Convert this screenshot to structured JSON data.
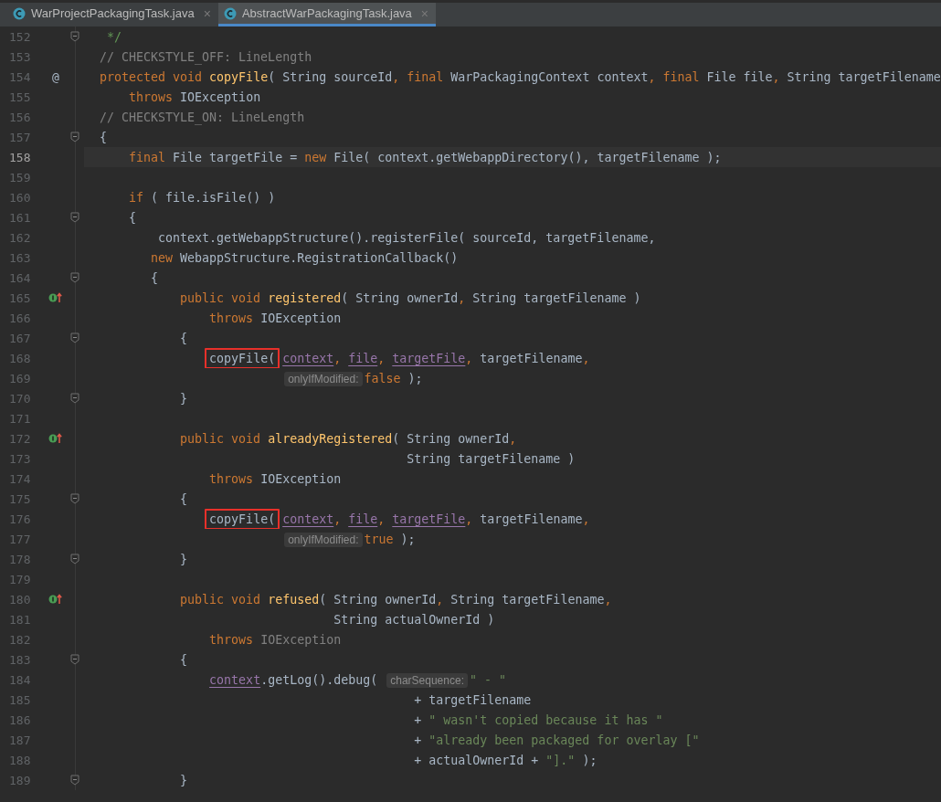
{
  "tabs": [
    {
      "label": "WarProjectPackagingTask.java",
      "close": "×",
      "selected": false
    },
    {
      "label": "AbstractWarPackagingTask.java",
      "close": "×",
      "selected": true
    }
  ],
  "lines": [
    {
      "number": "152",
      "fold": true,
      "segments": [
        {
          "kind": "doc",
          "text": " */"
        }
      ]
    },
    {
      "number": "153",
      "segments": [
        {
          "kind": "comment",
          "text": "// CHECKSTYLE_OFF: LineLength"
        }
      ]
    },
    {
      "number": "154",
      "annotation": "@",
      "segments": [
        {
          "kind": "kw",
          "text": "protected void "
        },
        {
          "kind": "decl",
          "text": "copyFile"
        },
        {
          "kind": "plain",
          "text": "( String sourceId"
        },
        {
          "kind": "kw",
          "text": ", final "
        },
        {
          "kind": "plain",
          "text": "WarPackagingContext context"
        },
        {
          "kind": "kw",
          "text": ", final "
        },
        {
          "kind": "plain",
          "text": "File file"
        },
        {
          "kind": "kw",
          "text": ", "
        },
        {
          "kind": "plain",
          "text": "String targetFilename"
        }
      ]
    },
    {
      "number": "155",
      "segments": [
        {
          "kind": "kw",
          "text": "    throws "
        },
        {
          "kind": "plain",
          "text": "IOException"
        }
      ]
    },
    {
      "number": "156",
      "segments": [
        {
          "kind": "comment",
          "text": "// CHECKSTYLE_ON: LineLength"
        }
      ]
    },
    {
      "number": "157",
      "fold": true,
      "segments": [
        {
          "kind": "plain",
          "text": "{"
        }
      ]
    },
    {
      "number": "158",
      "current": true,
      "segments": [
        {
          "kind": "kw",
          "text": "    final "
        },
        {
          "kind": "plain",
          "text": "File targetFile = "
        },
        {
          "kind": "kw",
          "text": "new "
        },
        {
          "kind": "plain",
          "text": "File( context.getWebappDirectory(), targetFilename );"
        }
      ]
    },
    {
      "number": "159"
    },
    {
      "number": "160",
      "segments": [
        {
          "kind": "kw",
          "text": "    if "
        },
        {
          "kind": "plain",
          "text": "( file.isFile() )"
        }
      ]
    },
    {
      "number": "161",
      "fold": true,
      "segments": [
        {
          "kind": "plain",
          "text": "    {"
        }
      ]
    },
    {
      "number": "162",
      "segments": [
        {
          "kind": "plain",
          "text": "        context.getWebappStructure().registerFile( sourceId, targetFilename,"
        }
      ]
    },
    {
      "number": "163",
      "segments": [
        {
          "kind": "kw",
          "text": "       new "
        },
        {
          "kind": "plain",
          "text": "WebappStructure.RegistrationCallback()"
        }
      ]
    },
    {
      "number": "164",
      "fold": true,
      "segments": [
        {
          "kind": "plain",
          "text": "       {"
        }
      ]
    },
    {
      "number": "165",
      "implements": true,
      "segments": [
        {
          "kind": "kw",
          "text": "           public void "
        },
        {
          "kind": "decl",
          "text": "registered"
        },
        {
          "kind": "plain",
          "text": "( String ownerId"
        },
        {
          "kind": "kw",
          "text": ", "
        },
        {
          "kind": "plain",
          "text": "String targetFilename )"
        }
      ]
    },
    {
      "number": "166",
      "segments": [
        {
          "kind": "kw",
          "text": "               throws "
        },
        {
          "kind": "plain",
          "text": "IOException"
        }
      ]
    },
    {
      "number": "167",
      "fold": true,
      "segments": [
        {
          "kind": "plain",
          "text": "           {"
        }
      ]
    },
    {
      "number": "168",
      "segments": [
        {
          "kind": "plain",
          "text": "               copyFile(",
          "boxed": true
        },
        {
          "kind": "param",
          "text": " context"
        },
        {
          "kind": "kw",
          "text": ", "
        },
        {
          "kind": "param",
          "text": "file"
        },
        {
          "kind": "kw",
          "text": ", "
        },
        {
          "kind": "param",
          "text": "targetFile"
        },
        {
          "kind": "kw",
          "text": ", "
        },
        {
          "kind": "plain",
          "text": "targetFilename"
        },
        {
          "kind": "kw",
          "text": ","
        }
      ]
    },
    {
      "number": "169",
      "segments": [
        {
          "kind": "hint",
          "text": "                         onlyIfModified:"
        },
        {
          "kind": "kw",
          "text": "false"
        },
        {
          "kind": "plain",
          "text": " );"
        }
      ]
    },
    {
      "number": "170",
      "fold": true,
      "segments": [
        {
          "kind": "plain",
          "text": "           }"
        }
      ]
    },
    {
      "number": "171"
    },
    {
      "number": "172",
      "implements": true,
      "segments": [
        {
          "kind": "kw",
          "text": "           public void "
        },
        {
          "kind": "decl",
          "text": "alreadyRegistered"
        },
        {
          "kind": "plain",
          "text": "( String ownerId"
        },
        {
          "kind": "kw",
          "text": ","
        }
      ]
    },
    {
      "number": "173",
      "segments": [
        {
          "kind": "plain",
          "text": "                                          String targetFilename )"
        }
      ]
    },
    {
      "number": "174",
      "segments": [
        {
          "kind": "kw",
          "text": "               throws "
        },
        {
          "kind": "plain",
          "text": "IOException"
        }
      ]
    },
    {
      "number": "175",
      "fold": true,
      "segments": [
        {
          "kind": "plain",
          "text": "           {"
        }
      ]
    },
    {
      "number": "176",
      "segments": [
        {
          "kind": "plain",
          "text": "               copyFile(",
          "boxed": true
        },
        {
          "kind": "param",
          "text": " context"
        },
        {
          "kind": "kw",
          "text": ", "
        },
        {
          "kind": "param",
          "text": "file"
        },
        {
          "kind": "kw",
          "text": ", "
        },
        {
          "kind": "param",
          "text": "targetFile"
        },
        {
          "kind": "kw",
          "text": ", "
        },
        {
          "kind": "plain",
          "text": "targetFilename"
        },
        {
          "kind": "kw",
          "text": ","
        }
      ]
    },
    {
      "number": "177",
      "segments": [
        {
          "kind": "hint",
          "text": "                         onlyIfModified:"
        },
        {
          "kind": "kw",
          "text": "true"
        },
        {
          "kind": "plain",
          "text": " );"
        }
      ]
    },
    {
      "number": "178",
      "fold": true,
      "segments": [
        {
          "kind": "plain",
          "text": "           }"
        }
      ]
    },
    {
      "number": "179"
    },
    {
      "number": "180",
      "implements": true,
      "segments": [
        {
          "kind": "kw",
          "text": "           public void "
        },
        {
          "kind": "decl",
          "text": "refused"
        },
        {
          "kind": "plain",
          "text": "( String ownerId"
        },
        {
          "kind": "kw",
          "text": ", "
        },
        {
          "kind": "plain",
          "text": "String targetFilename"
        },
        {
          "kind": "kw",
          "text": ","
        }
      ]
    },
    {
      "number": "181",
      "segments": [
        {
          "kind": "plain",
          "text": "                                String actualOwnerId )"
        }
      ]
    },
    {
      "number": "182",
      "segments": [
        {
          "kind": "kw",
          "text": "               throws "
        },
        {
          "kind": "dim",
          "text": "IOException"
        }
      ]
    },
    {
      "number": "183",
      "fold": true,
      "segments": [
        {
          "kind": "plain",
          "text": "           {"
        }
      ]
    },
    {
      "number": "184",
      "segments": [
        {
          "kind": "param",
          "text": "               context"
        },
        {
          "kind": "plain",
          "text": ".getLog().debug( "
        },
        {
          "kind": "hint",
          "text": "charSequence:"
        },
        {
          "kind": "str",
          "text": "\" - \""
        }
      ]
    },
    {
      "number": "185",
      "segments": [
        {
          "kind": "plain",
          "text": "                                           + targetFilename"
        }
      ]
    },
    {
      "number": "186",
      "segments": [
        {
          "kind": "plain",
          "text": "                                           + "
        },
        {
          "kind": "str",
          "text": "\" wasn't copied because it has \""
        }
      ]
    },
    {
      "number": "187",
      "segments": [
        {
          "kind": "plain",
          "text": "                                           + "
        },
        {
          "kind": "str",
          "text": "\"already been packaged for overlay [\""
        }
      ]
    },
    {
      "number": "188",
      "segments": [
        {
          "kind": "plain",
          "text": "                                           + actualOwnerId + "
        },
        {
          "kind": "str",
          "text": "\"].\""
        },
        {
          "kind": "plain",
          "text": " );"
        }
      ]
    },
    {
      "number": "189",
      "fold": true,
      "segments": [
        {
          "kind": "plain",
          "text": "           }"
        }
      ]
    }
  ]
}
